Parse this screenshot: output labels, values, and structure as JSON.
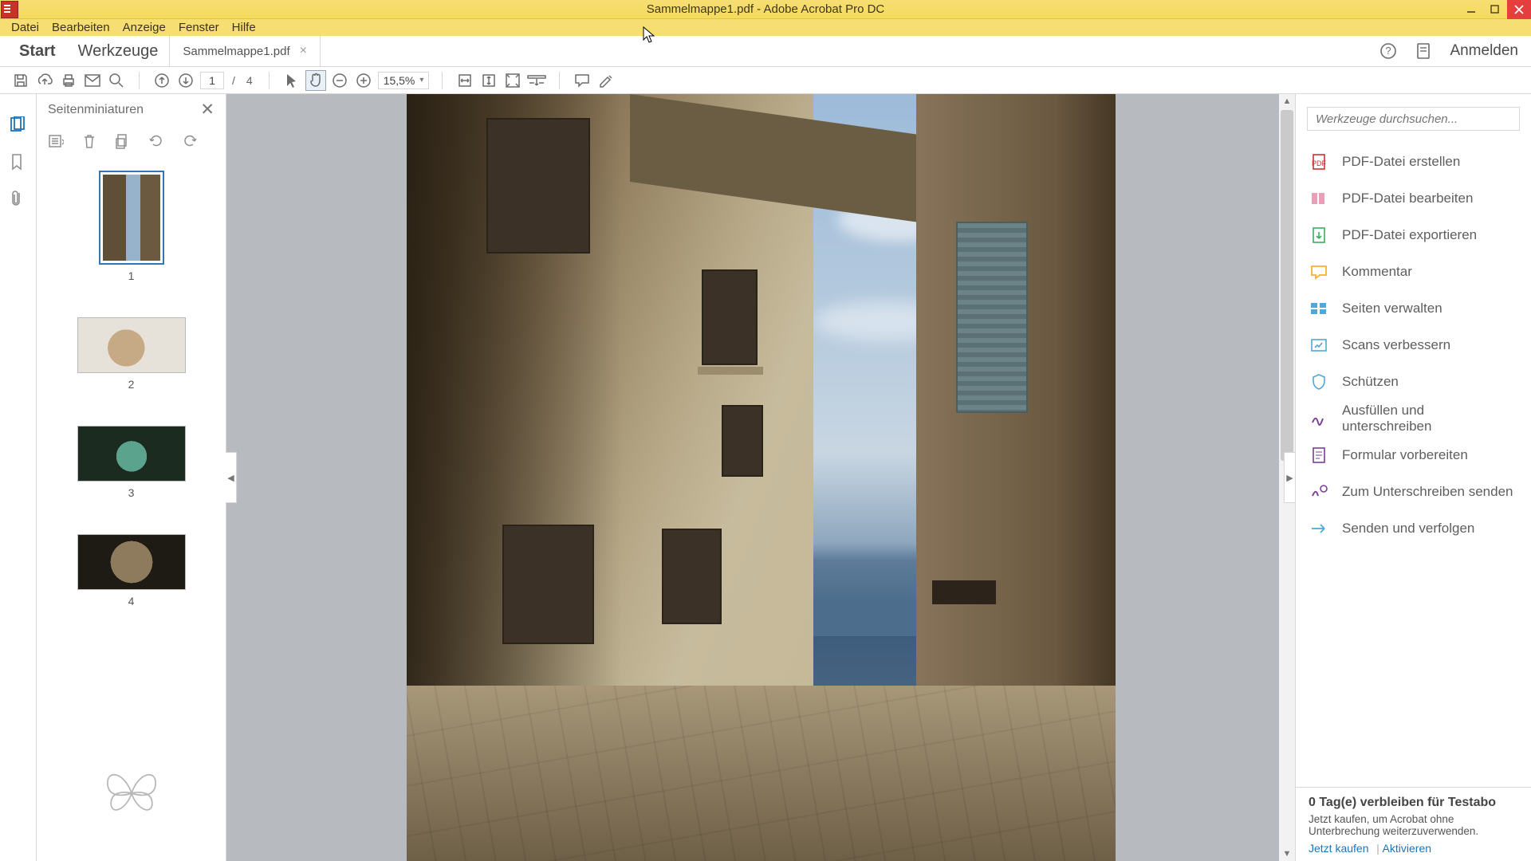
{
  "title": "Sammelmappe1.pdf - Adobe Acrobat Pro DC",
  "menu": {
    "datei": "Datei",
    "bearbeiten": "Bearbeiten",
    "anzeige": "Anzeige",
    "fenster": "Fenster",
    "hilfe": "Hilfe"
  },
  "tabs": {
    "start": "Start",
    "werkzeuge": "Werkzeuge",
    "file": "Sammelmappe1.pdf",
    "close_x": "×",
    "anmelden": "Anmelden"
  },
  "toolbar": {
    "page_current": "1",
    "page_sep": "/",
    "page_total": "4",
    "zoom": "15,5%"
  },
  "thumbs": {
    "header": "Seitenminiaturen",
    "close": "✕",
    "items": [
      {
        "num": "1"
      },
      {
        "num": "2"
      },
      {
        "num": "3"
      },
      {
        "num": "4"
      }
    ]
  },
  "right": {
    "search_placeholder": "Werkzeuge durchsuchen...",
    "tools": {
      "create": "PDF-Datei erstellen",
      "edit": "PDF-Datei bearbeiten",
      "export": "PDF-Datei exportieren",
      "comment": "Kommentar",
      "pages": "Seiten verwalten",
      "scans": "Scans verbessern",
      "protect": "Schützen",
      "fill": "Ausfüllen und unterschreiben",
      "form": "Formular vorbereiten",
      "send_sign": "Zum Unterschreiben senden",
      "send_track": "Senden und verfolgen"
    },
    "trial_head": "0 Tag(e) verbleiben für Testabo",
    "trial_body": "Jetzt kaufen, um Acrobat ohne Unterbrechung weiterzuverwenden.",
    "trial_buy": "Jetzt kaufen",
    "trial_div": "|",
    "trial_activate": "Aktivieren"
  }
}
